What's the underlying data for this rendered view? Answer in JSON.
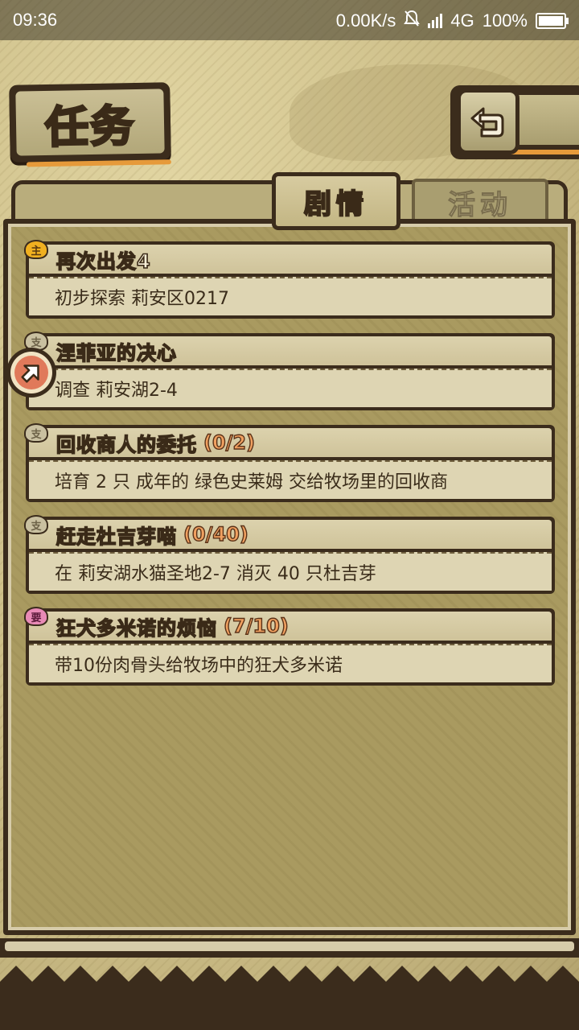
{
  "status_bar": {
    "time": "09:36",
    "net_speed": "0.00K/s",
    "network": "4G",
    "battery": "100%"
  },
  "header": {
    "title": "任务",
    "back_icon": "return-arrow-icon"
  },
  "tabs": [
    {
      "label": "剧情",
      "active": true
    },
    {
      "label": "活动",
      "active": false
    }
  ],
  "quests": [
    {
      "badge": "主",
      "badge_type": "main",
      "title": "再次出发4",
      "progress": "",
      "desc": "初步探索 莉安区0217"
    },
    {
      "badge": "支",
      "badge_type": "side",
      "title": "涅菲亚的决心",
      "progress": "",
      "desc": "调查 莉安湖2-4"
    },
    {
      "badge": "支",
      "badge_type": "side",
      "title": "回收商人的委托",
      "progress": "(0/2)",
      "desc": "培育 2 只 成年的 绿色史莱姆 交给牧场里的回收商"
    },
    {
      "badge": "支",
      "badge_type": "side",
      "title": "赶走杜吉芽喵",
      "progress": "(0/40)",
      "desc": "在 莉安湖水猫圣地2-7 消灭 40 只杜吉芽"
    },
    {
      "badge": "要",
      "badge_type": "req",
      "title": "狂犬多米诺的烦恼",
      "progress": "(7/10)",
      "desc": "带10份肉骨头给牧场中的狂犬多米诺"
    }
  ],
  "colors": {
    "frame": "#3b2c1c",
    "accent": "#e69a3a",
    "progress": "#f0a060"
  }
}
